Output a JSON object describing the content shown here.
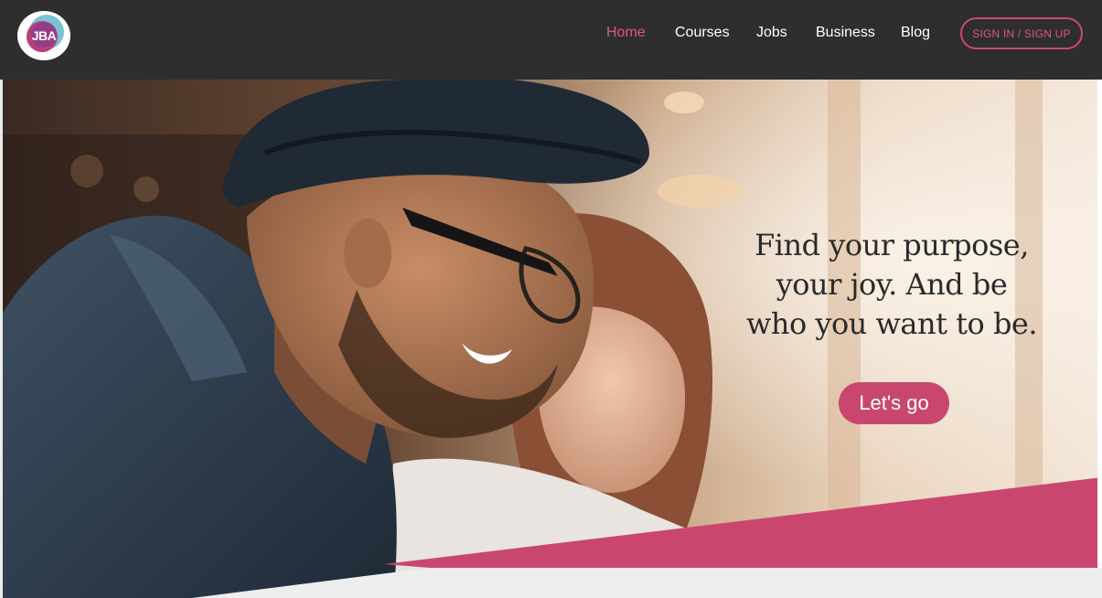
{
  "brand": {
    "logo_text": "JBA"
  },
  "nav": {
    "items": [
      {
        "label": "Home",
        "active": true
      },
      {
        "label": "Courses",
        "active": false
      },
      {
        "label": "Jobs",
        "active": false
      },
      {
        "label": "Business",
        "active": false
      },
      {
        "label": "Blog",
        "active": false
      }
    ],
    "signin_label": "SIGN IN / SIGN UP"
  },
  "hero": {
    "headline_lines": [
      "Find your purpose,",
      "your joy. And be",
      "who you want to be."
    ],
    "cta_label": "Let's go"
  },
  "colors": {
    "header_bg": "#2e2e2e",
    "accent": "#c9476f",
    "accent_text": "#e0577d",
    "footer_band": "#eeeeee"
  },
  "icons": {
    "logo": "jba-logo-badge"
  }
}
